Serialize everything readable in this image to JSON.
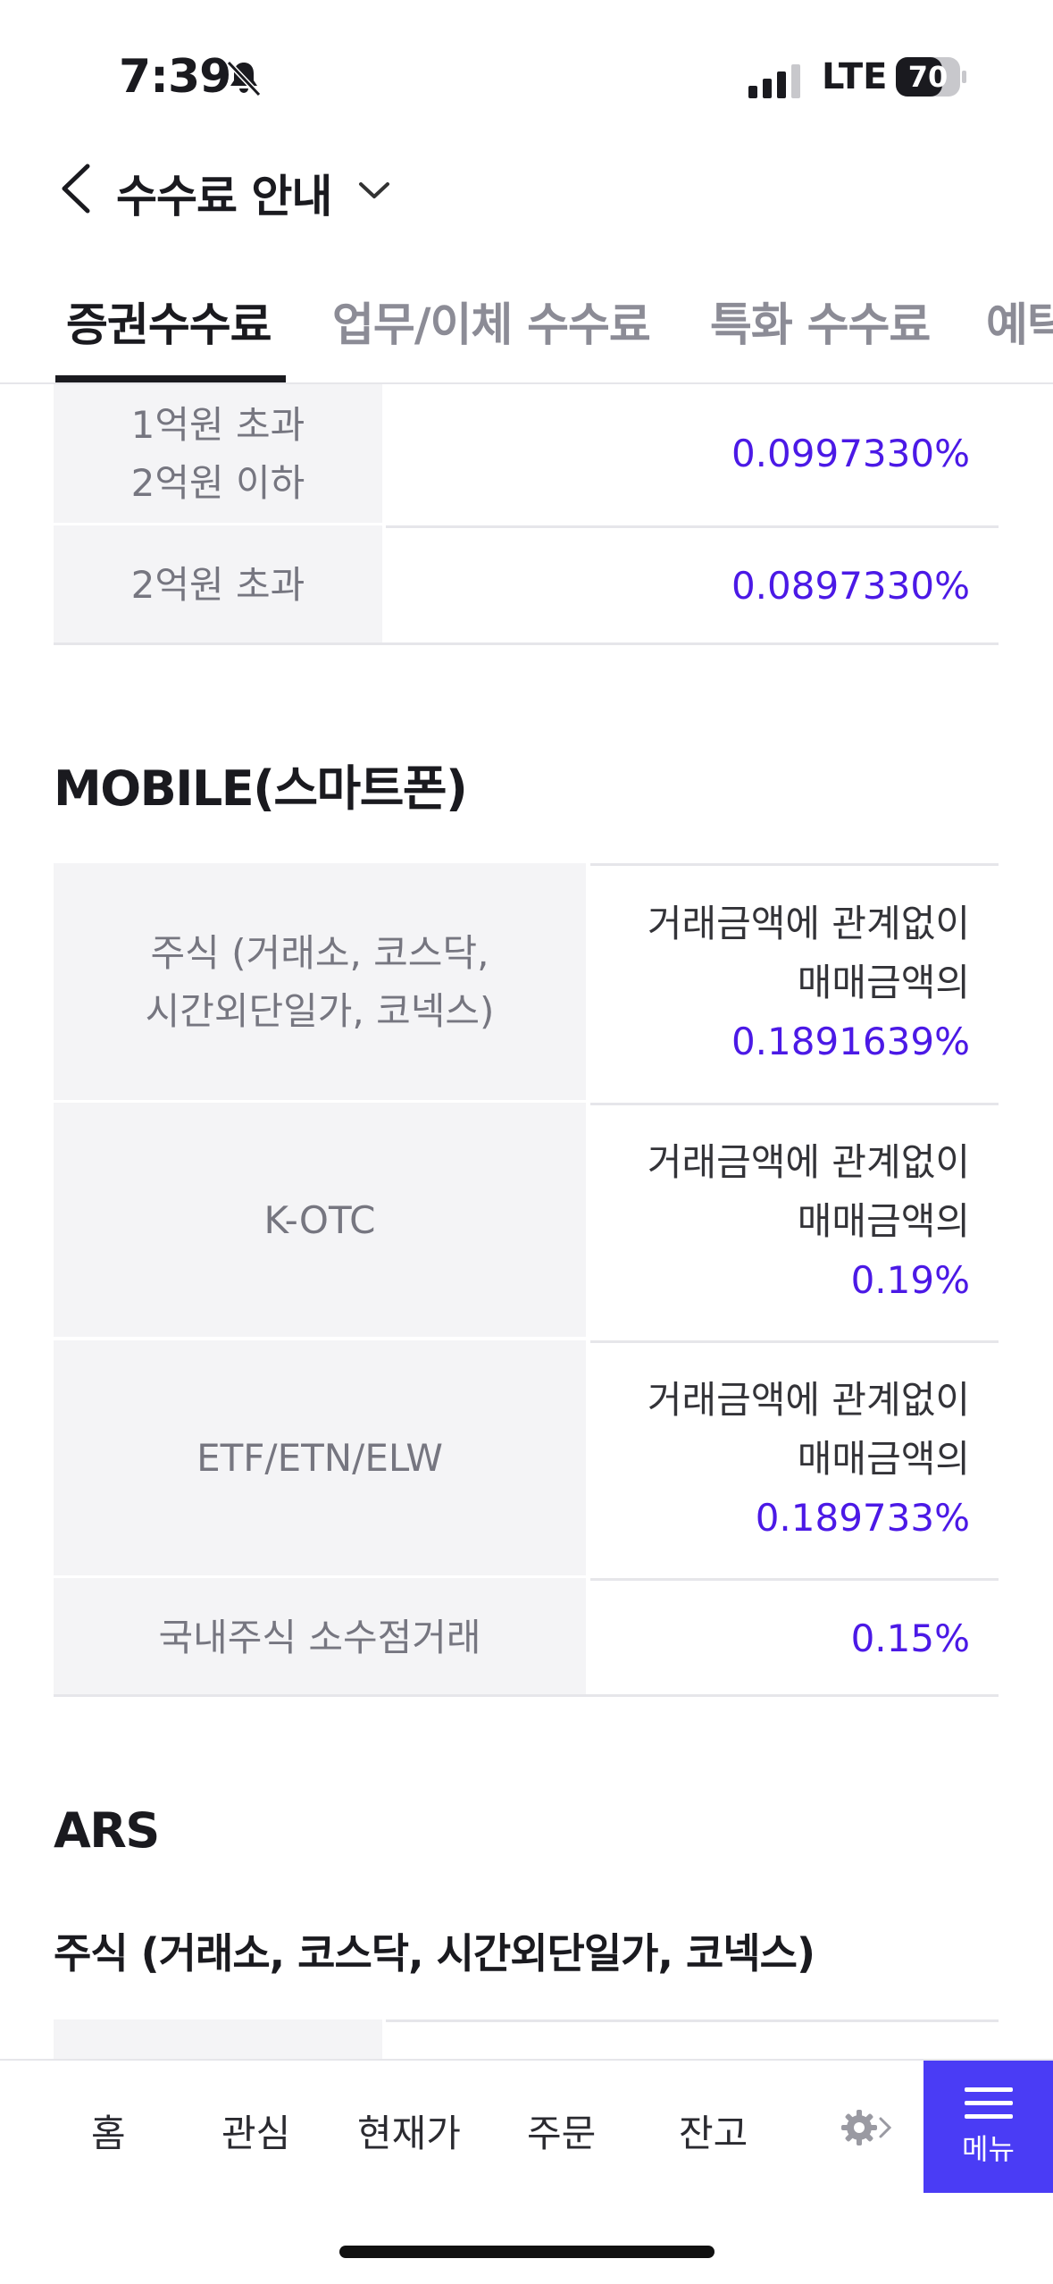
{
  "status": {
    "time": "7:39",
    "network": "LTE",
    "battery": "70"
  },
  "header": {
    "title": "수수료 안내"
  },
  "tabs": [
    "증권수수료",
    "업무/이체 수수료",
    "특화 수수료",
    "예탁"
  ],
  "top_table": [
    {
      "label": "1억원 초과\n2억원 이하",
      "value": "0.0997330%"
    },
    {
      "label": "2억원 초과",
      "value": "0.0897330%"
    }
  ],
  "mobile": {
    "heading": "MOBILE(스마트폰)",
    "rows": [
      {
        "label": "주식 (거래소, 코스닥,\n시간외단일가, 코넥스)",
        "line1": "거래금액에 관계없이",
        "line2": "매매금액의",
        "value": "0.1891639%"
      },
      {
        "label": "K-OTC",
        "line1": "거래금액에 관계없이",
        "line2": "매매금액의",
        "value": "0.19%"
      },
      {
        "label": "ETF/ETN/ELW",
        "line1": "거래금액에 관계없이",
        "line2": "매매금액의",
        "value": "0.189733%"
      },
      {
        "label": "국내주식 소수점거래",
        "value": "0.15%"
      }
    ]
  },
  "ars": {
    "heading": "ARS",
    "subheading": "주식 (거래소, 코스닥, 시간외단일가, 코넥스)"
  },
  "bottom_nav": {
    "items": [
      "홈",
      "관심",
      "현재가",
      "주문",
      "잔고"
    ],
    "menu_label": "메뉴"
  }
}
